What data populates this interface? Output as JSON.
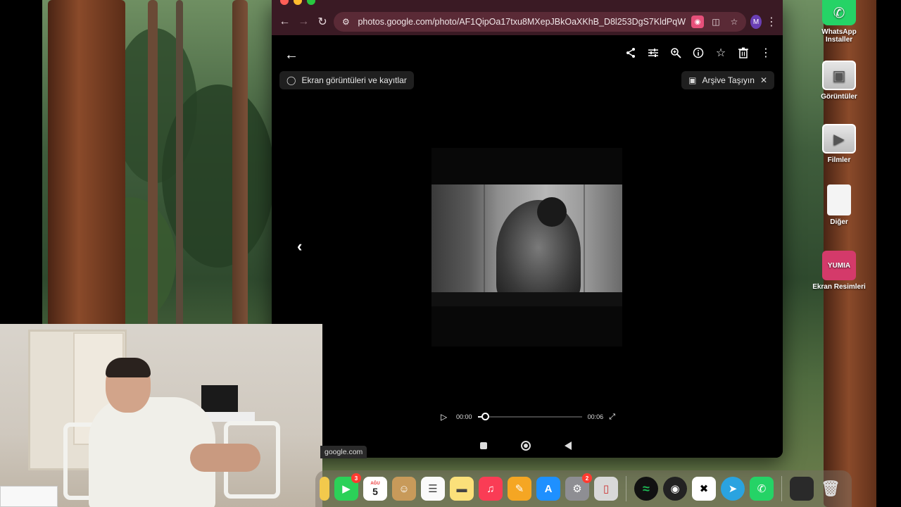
{
  "browser": {
    "url": "photos.google.com/photo/AF1QipOa17txu8MXepJBkOaXKhB_D8l253DgS7KldPqW",
    "profile_initial": "M"
  },
  "viewer": {
    "tag_chip": "Ekran görüntüleri ve kayıtlar",
    "archive_chip": "Arşive Taşıyın",
    "time_current": "00:00",
    "time_total": "00:06",
    "seek_progress_fraction": 0.07
  },
  "desktop_icons": [
    {
      "label": "WhatsApp Installer",
      "icon": "whatsapp-icon"
    },
    {
      "label": "Görüntüler",
      "icon": "folder-photos-icon"
    },
    {
      "label": "Filmler",
      "icon": "folder-movies-icon"
    },
    {
      "label": "Diğer",
      "icon": "document-icon"
    },
    {
      "label": "Ekran Resimleri",
      "icon": "folder-screenshots-icon"
    }
  ],
  "status_link": "google.com",
  "dock": {
    "facetime_badge": "3",
    "calendar_month": "AĞU",
    "calendar_day": "5",
    "settings_badge": "2"
  },
  "colors": {
    "chrome_bg": "#3a1a24",
    "omnibox_bg": "#5a2a36",
    "accent_profile": "#6a3fb5",
    "spotify": "#1db954",
    "whatsapp": "#25d366"
  }
}
